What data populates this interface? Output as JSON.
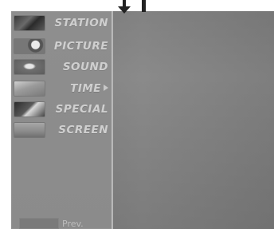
{
  "menu": {
    "items": [
      {
        "label": "STATION",
        "icon": "station-thumbnail-icon",
        "has_submenu": false
      },
      {
        "label": "PICTURE",
        "icon": "picture-thumbnail-icon",
        "has_submenu": false
      },
      {
        "label": "SOUND",
        "icon": "sound-thumbnail-icon",
        "has_submenu": false
      },
      {
        "label": "TIME",
        "icon": "time-thumbnail-icon",
        "has_submenu": true
      },
      {
        "label": "SPECIAL",
        "icon": "special-thumbnail-icon",
        "has_submenu": false
      },
      {
        "label": "SCREEN",
        "icon": "screen-thumbnail-icon",
        "has_submenu": false
      }
    ],
    "footer": {
      "prev_label": "Prev."
    }
  },
  "indicators": {
    "down_arrow_icon": "down-arrow-icon",
    "bar_marker_icon": "bar-marker-icon"
  }
}
